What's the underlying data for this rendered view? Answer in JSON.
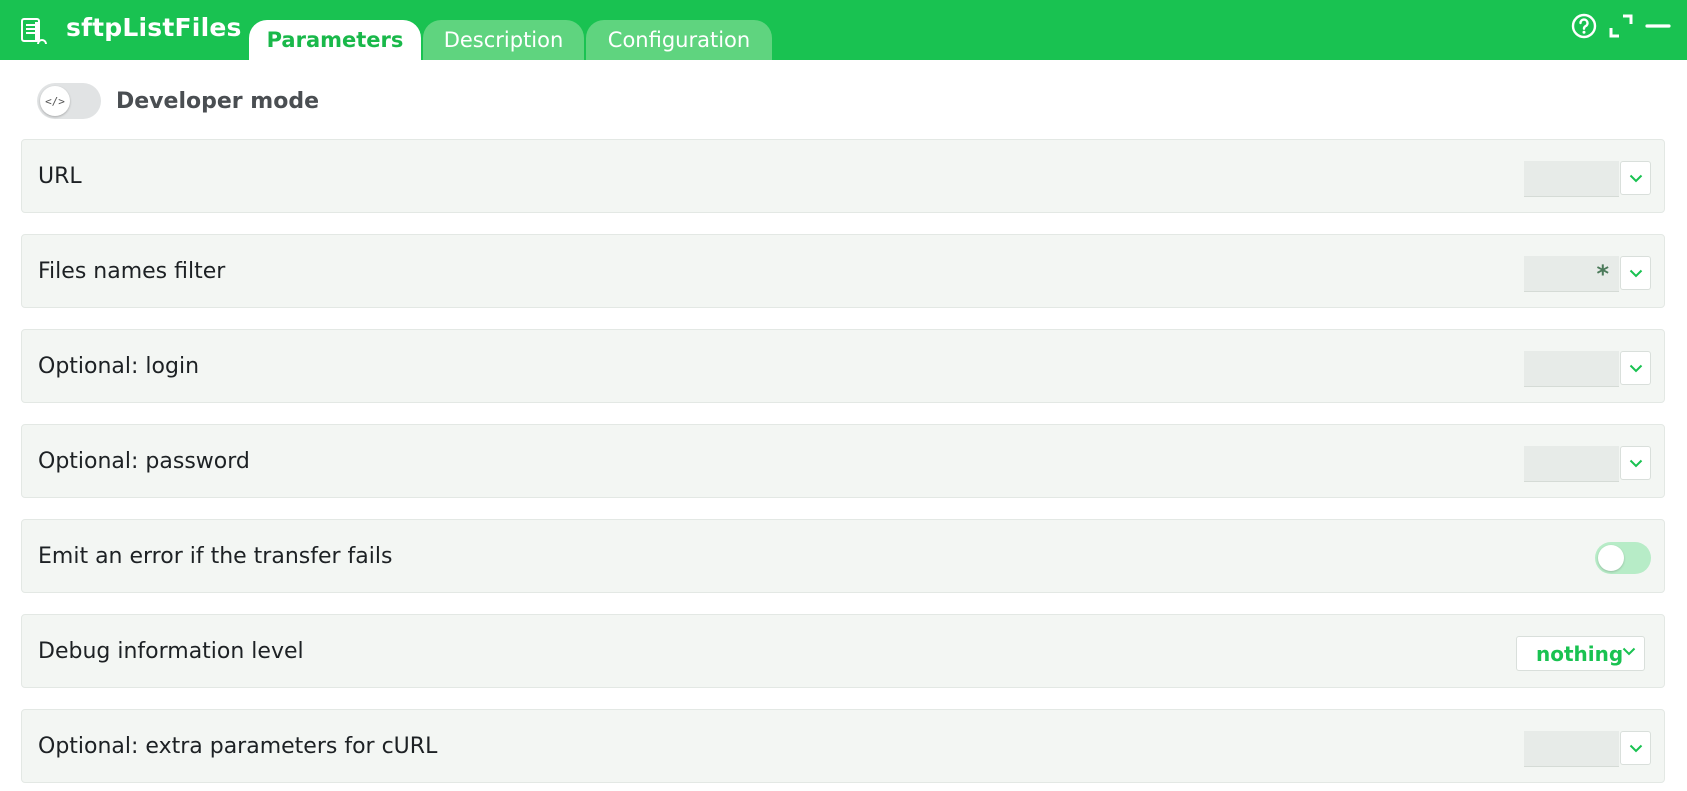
{
  "header": {
    "title": "sftpListFiles",
    "app_icon": "file-list-icon",
    "tabs": [
      {
        "label": "Parameters",
        "active": true
      },
      {
        "label": "Description",
        "active": false
      },
      {
        "label": "Configuration",
        "active": false
      }
    ],
    "controls": [
      "help-icon",
      "fullscreen-icon",
      "minimize-icon"
    ]
  },
  "developer_mode": {
    "label": "Developer mode",
    "knob_symbol": "</>",
    "enabled": false
  },
  "parameters": [
    {
      "label": "URL",
      "value": "",
      "control": "dropdown"
    },
    {
      "label": "Files names filter",
      "value": "*",
      "control": "dropdown"
    },
    {
      "label": "Optional: login",
      "value": "",
      "control": "dropdown"
    },
    {
      "label": "Optional: password",
      "value": "",
      "control": "dropdown"
    },
    {
      "label": "Emit an error if the transfer fails",
      "value": "off",
      "control": "toggle"
    },
    {
      "label": "Debug information level",
      "value": "nothing",
      "control": "select"
    },
    {
      "label": "Optional: extra parameters for cURL",
      "value": "",
      "control": "dropdown"
    }
  ],
  "colors": {
    "accent": "#19c251",
    "row_bg": "#f3f6f3",
    "toggle_off": "#b7ecc7"
  }
}
